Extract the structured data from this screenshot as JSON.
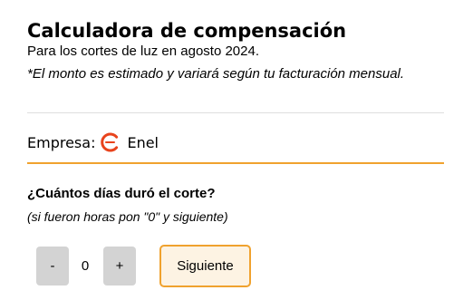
{
  "header": {
    "title": "Calculadora de compensación",
    "subtitle": "Para los cortes de luz en agosto 2024.",
    "note": "*El monto es estimado y variará según tu facturación mensual."
  },
  "company": {
    "label": "Empresa:",
    "name": "Enel",
    "logo_icon": "enel-logo-icon"
  },
  "question": {
    "title": "¿Cuántos días duró el corte?",
    "hint": "(si fueron horas pon \"0\" y siguiente)"
  },
  "stepper": {
    "decrement_label": "-",
    "value": "0",
    "increment_label": "+"
  },
  "next_button": {
    "label": "Siguiente"
  },
  "colors": {
    "accent": "#f0a22e",
    "button_bg": "#d3d3d3",
    "next_button_bg": "#fdf3e3",
    "logo_red": "#e8431c",
    "divider": "#dedede"
  }
}
